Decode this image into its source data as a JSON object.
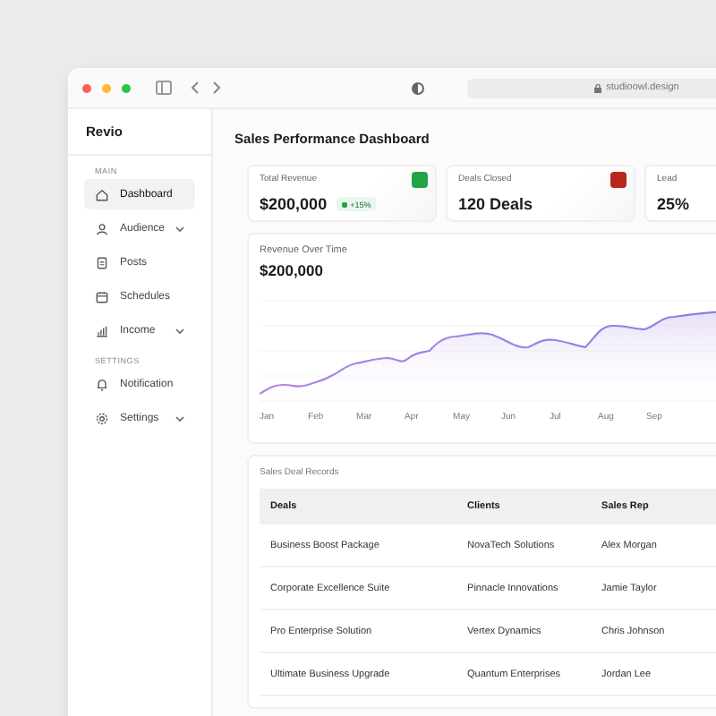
{
  "browser": {
    "url": "studioowl.design"
  },
  "sidebar": {
    "brand": "Revio",
    "sections": [
      {
        "label": "MAIN",
        "items": [
          {
            "label": "Dashboard",
            "selected": true,
            "has_submenu": false
          },
          {
            "label": "Audience",
            "selected": false,
            "has_submenu": true
          },
          {
            "label": "Posts",
            "selected": false,
            "has_submenu": false
          },
          {
            "label": "Schedules",
            "selected": false,
            "has_submenu": false
          },
          {
            "label": "Income",
            "selected": false,
            "has_submenu": true
          }
        ]
      },
      {
        "label": "SETTINGS",
        "items": [
          {
            "label": "Notification",
            "selected": false,
            "has_submenu": false
          },
          {
            "label": "Settings",
            "selected": false,
            "has_submenu": true
          }
        ]
      }
    ]
  },
  "page_title": "Sales Performance Dashboard",
  "stats": [
    {
      "label": "Total Revenue",
      "value": "$200,000",
      "badge": "+15%",
      "color": "#22a447"
    },
    {
      "label": "Deals Closed",
      "value": "120 Deals",
      "color": "#b8261c"
    },
    {
      "label": "Lead",
      "value": "25%"
    }
  ],
  "revenue_chart": {
    "title": "Revenue Over Time",
    "value": "$200,000",
    "x_labels": [
      "Jan",
      "Feb",
      "Mar",
      "Apr",
      "May",
      "Jun",
      "Jul",
      "Aug",
      "Sep"
    ]
  },
  "deals_table": {
    "title": "Sales Deal Records",
    "columns": [
      "Deals",
      "Clients",
      "Sales Rep"
    ],
    "rows": [
      [
        "Business Boost Package",
        "NovaTech Solutions",
        "Alex Morgan"
      ],
      [
        "Corporate Excellence Suite",
        "Pinnacle Innovations",
        "Jamie Taylor"
      ],
      [
        "Pro Enterprise Solution",
        "Vertex Dynamics",
        "Chris Johnson"
      ],
      [
        "Ultimate Business Upgrade",
        "Quantum Enterprises",
        "Jordan Lee"
      ]
    ]
  }
}
